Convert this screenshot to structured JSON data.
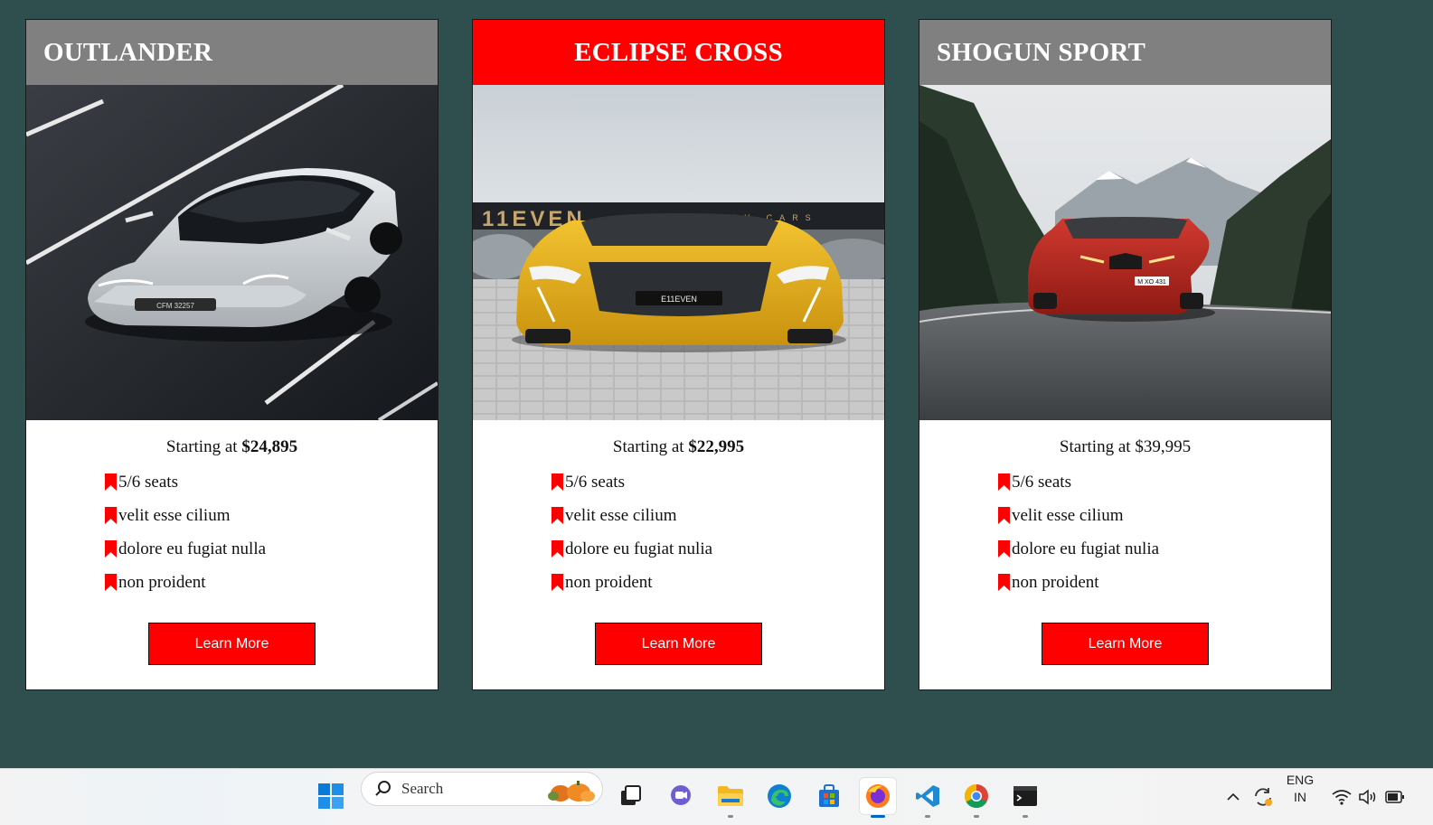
{
  "cards": [
    {
      "title": "OUTLANDER",
      "price_prefix": "Starting at",
      "price": "$24,895",
      "price_bold": true,
      "features": [
        "5/6 seats",
        "velit esse cilium",
        "dolore eu fugiat nulla",
        "non proident"
      ],
      "button_label": "Learn More"
    },
    {
      "title": "ECLIPSE CROSS",
      "price_prefix": "Starting at",
      "price": "$22,995",
      "price_bold": true,
      "features": [
        "5/6 seats",
        "velit esse cilium",
        "dolore eu fugiat nulia",
        "non proident"
      ],
      "button_label": "Learn More"
    },
    {
      "title": "SHOGUN SPORT",
      "price_prefix": "Starting at",
      "price": "$39,995",
      "price_bold": false,
      "features": [
        "5/6 seats",
        "velit esse cilium",
        "dolore eu fugiat nulia",
        "non proident"
      ],
      "button_label": "Learn More"
    }
  ],
  "photo_text": {
    "card1_plate": "CFM 32257",
    "card2_sign": "11EVEN",
    "card2_sign_sub": "LUXURY CARS",
    "card2_plate": "E11EVEN",
    "card3_plate": "M XO 431"
  },
  "colors": {
    "page_background": "#2f4f4f",
    "accent_red": "#ff0000",
    "header_gray": "#808080",
    "card_background": "#ffffff"
  },
  "taskbar": {
    "search_placeholder": "Search",
    "apps": [
      "windows-start",
      "search",
      "task-view",
      "teams-chat",
      "file-explorer",
      "edge",
      "microsoft-store",
      "firefox",
      "vs-code",
      "chrome",
      "terminal"
    ],
    "active_app": "firefox",
    "language_line1": "ENG",
    "language_line2": "IN"
  }
}
